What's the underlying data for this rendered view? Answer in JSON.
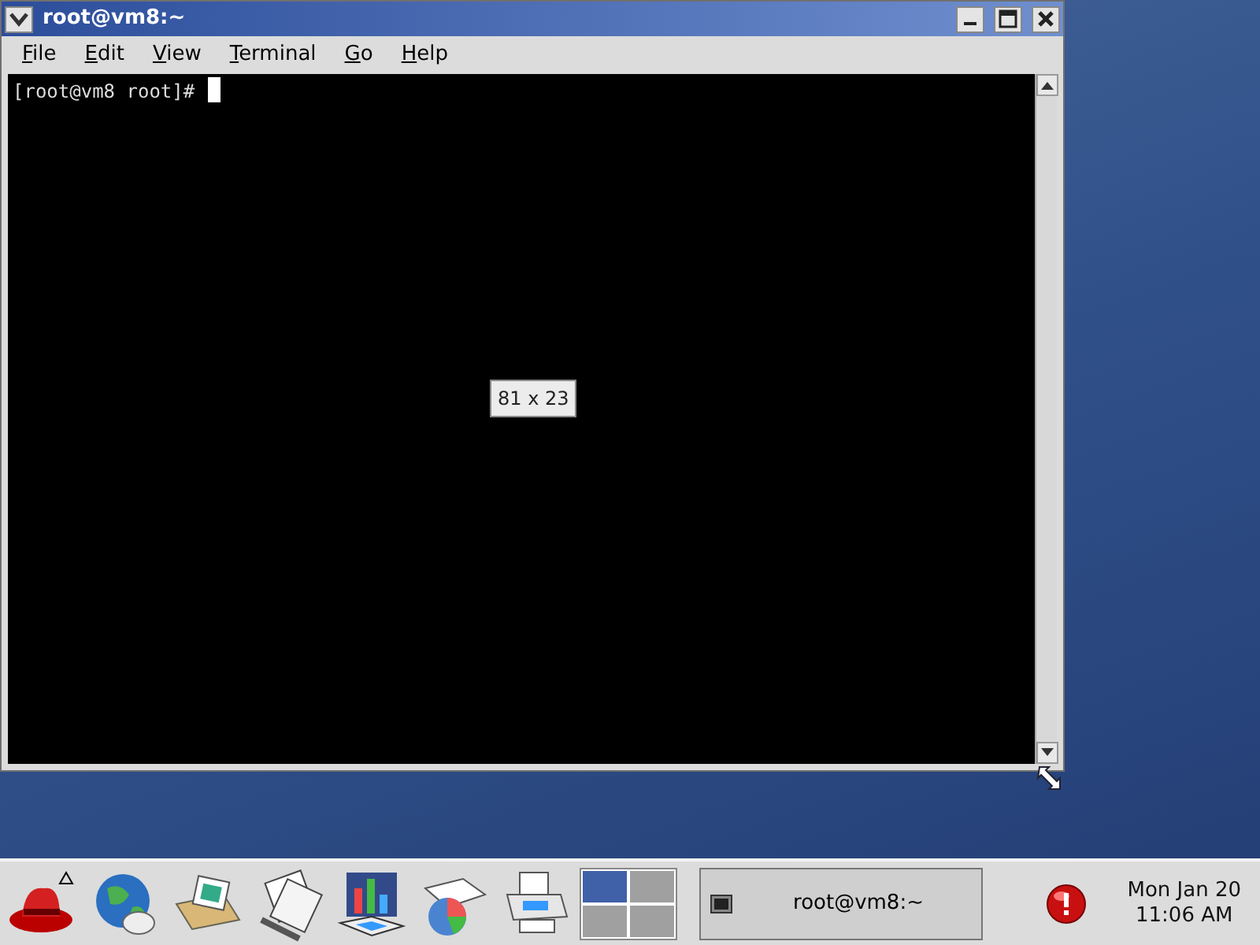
{
  "window": {
    "title": "root@vm8:~",
    "menu": [
      {
        "label": "File"
      },
      {
        "label": "Edit"
      },
      {
        "label": "View"
      },
      {
        "label": "Terminal"
      },
      {
        "label": "Go"
      },
      {
        "label": "Help"
      }
    ],
    "terminal": {
      "prompt": "[root@vm8 root]#"
    },
    "resize_tooltip": "81 x 23"
  },
  "taskbar": {
    "launchers": [
      {
        "kind": "hat"
      },
      {
        "kind": "globe"
      },
      {
        "kind": "folder"
      },
      {
        "kind": "documents"
      },
      {
        "kind": "chart"
      },
      {
        "kind": "pie"
      },
      {
        "kind": "printer"
      }
    ],
    "workspaces": [
      {
        "selected": true
      },
      {
        "selected": false
      },
      {
        "selected": false
      },
      {
        "selected": false
      }
    ],
    "tasks": [
      {
        "label": "root@vm8:~",
        "selected": false
      }
    ],
    "clock": {
      "date": "Mon Jan 20",
      "time": "11:06 AM"
    }
  }
}
